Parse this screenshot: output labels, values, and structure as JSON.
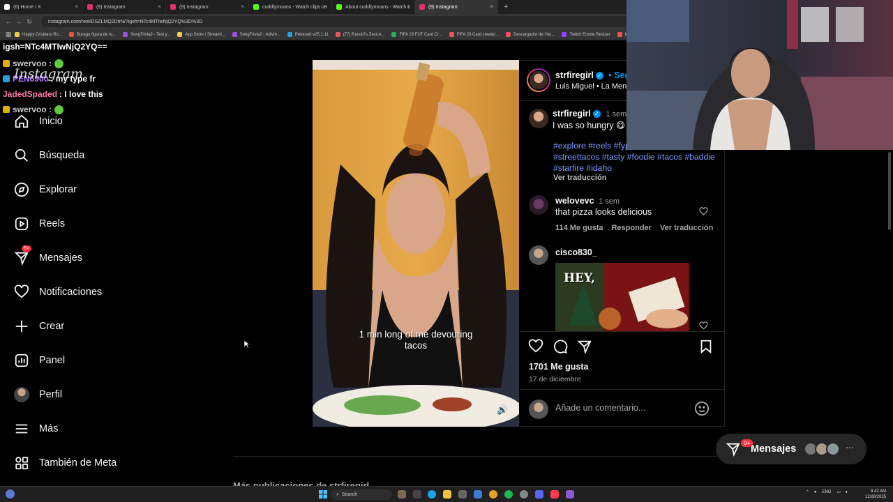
{
  "browser": {
    "tabs": [
      {
        "title": "(6) Home / X",
        "color": "#ffffff",
        "active": false
      },
      {
        "title": "(9) Instagram",
        "color": "#e1306c",
        "active": false
      },
      {
        "title": "(9) Instagram",
        "color": "#e1306c",
        "active": false
      },
      {
        "title": "cuddlymoans - Watch clips on",
        "color": "#53fc18",
        "active": false
      },
      {
        "title": "About cuddlymoans - Watch L",
        "color": "#53fc18",
        "active": false
      },
      {
        "title": "(9) Instagram",
        "color": "#e1306c",
        "active": true
      }
    ],
    "url": "instagram.com/reel/DSZLMQ2DtrN/?igsh=NTc4MTIwNjQ2YQ%3D%3D",
    "bookmarks": [
      {
        "label": "Happy Cristiano Ro...",
        "color": "#f2c94c"
      },
      {
        "label": "Burago figura de to...",
        "color": "#e8553a"
      },
      {
        "label": "SongTrivia2 - Test y...",
        "color": "#9b51e0"
      },
      {
        "label": "App Store / Streami...",
        "color": "#f2c94c"
      },
      {
        "label": "SongTrivia2 - Adivin...",
        "color": "#9b51e0"
      },
      {
        "label": "Pelotoob v25.1.11",
        "color": "#2d9cdb"
      },
      {
        "label": "(77) Racoli?s Zest-A...",
        "color": "#eb5757"
      },
      {
        "label": "FIFA 23 FUT Card Cr...",
        "color": "#27ae60"
      },
      {
        "label": "FIFA 23 Card creator...",
        "color": "#eb5757"
      },
      {
        "label": "Descargador de You...",
        "color": "#eb5757"
      },
      {
        "label": "Twitch Emote Resizer",
        "color": "#9146ff"
      },
      {
        "label": "twitch em",
        "color": "#eb5757"
      }
    ]
  },
  "chat_overlay": {
    "header": "igsh=NTc4MTIwNjQ2YQ==",
    "messages": [
      {
        "user": "swervoo :",
        "text": ""
      },
      {
        "user": "PEN6900",
        "text": ": my type fr"
      },
      {
        "user": "JadedSpaded",
        "text": ": I love this"
      },
      {
        "user": "swervoo :",
        "text": ""
      }
    ],
    "wordmark": "Instagram"
  },
  "sidebar": {
    "items": [
      {
        "label": "Inicio",
        "icon": "home-icon"
      },
      {
        "label": "Búsqueda",
        "icon": "search-icon"
      },
      {
        "label": "Explorar",
        "icon": "compass-icon"
      },
      {
        "label": "Reels",
        "icon": "reels-icon"
      },
      {
        "label": "Mensajes",
        "icon": "messenger-icon",
        "badge": "9+"
      },
      {
        "label": "Notificaciones",
        "icon": "heart-icon"
      },
      {
        "label": "Crear",
        "icon": "plus-icon"
      },
      {
        "label": "Panel",
        "icon": "chart-icon"
      },
      {
        "label": "Perfil",
        "icon": "avatar"
      },
      {
        "label": "Más",
        "icon": "menu-icon"
      },
      {
        "label": "También de Meta",
        "icon": "meta-grid-icon"
      }
    ]
  },
  "reel": {
    "caption": "1 min long of me devouring tacos"
  },
  "post": {
    "author": "strfiregirl",
    "follow_label": "Segu",
    "audio": "Luis Miguel • La Ment",
    "caption_time": "1 sem",
    "caption_text": "I was so hungry",
    "hashtags": "#explore #reels #fyp #foodreviews #streettacos #tasty #foodie #tacos #baddie #starfire #idaho",
    "translate_label": "Ver traducción",
    "comments": [
      {
        "user": "welovevc",
        "time": "1 sem",
        "text": "that pizza looks delicious",
        "likes": "114 Me gusta",
        "reply": "Responder",
        "translate": "Ver traducción"
      },
      {
        "user": "cisco830_",
        "gif_text": "HEY,"
      }
    ],
    "likes": "1701 Me gusta",
    "date": "17 de diciembre",
    "comment_placeholder": "Añade un comentario..."
  },
  "below": {
    "more_from": "Más publicaciones de strfiregirl"
  },
  "messages_pill": {
    "label": "Mensajes",
    "badge": "9+"
  },
  "taskbar": {
    "search": "Search",
    "lang": "ENG",
    "time": "8:42 AM",
    "date": "12/28/2025"
  }
}
